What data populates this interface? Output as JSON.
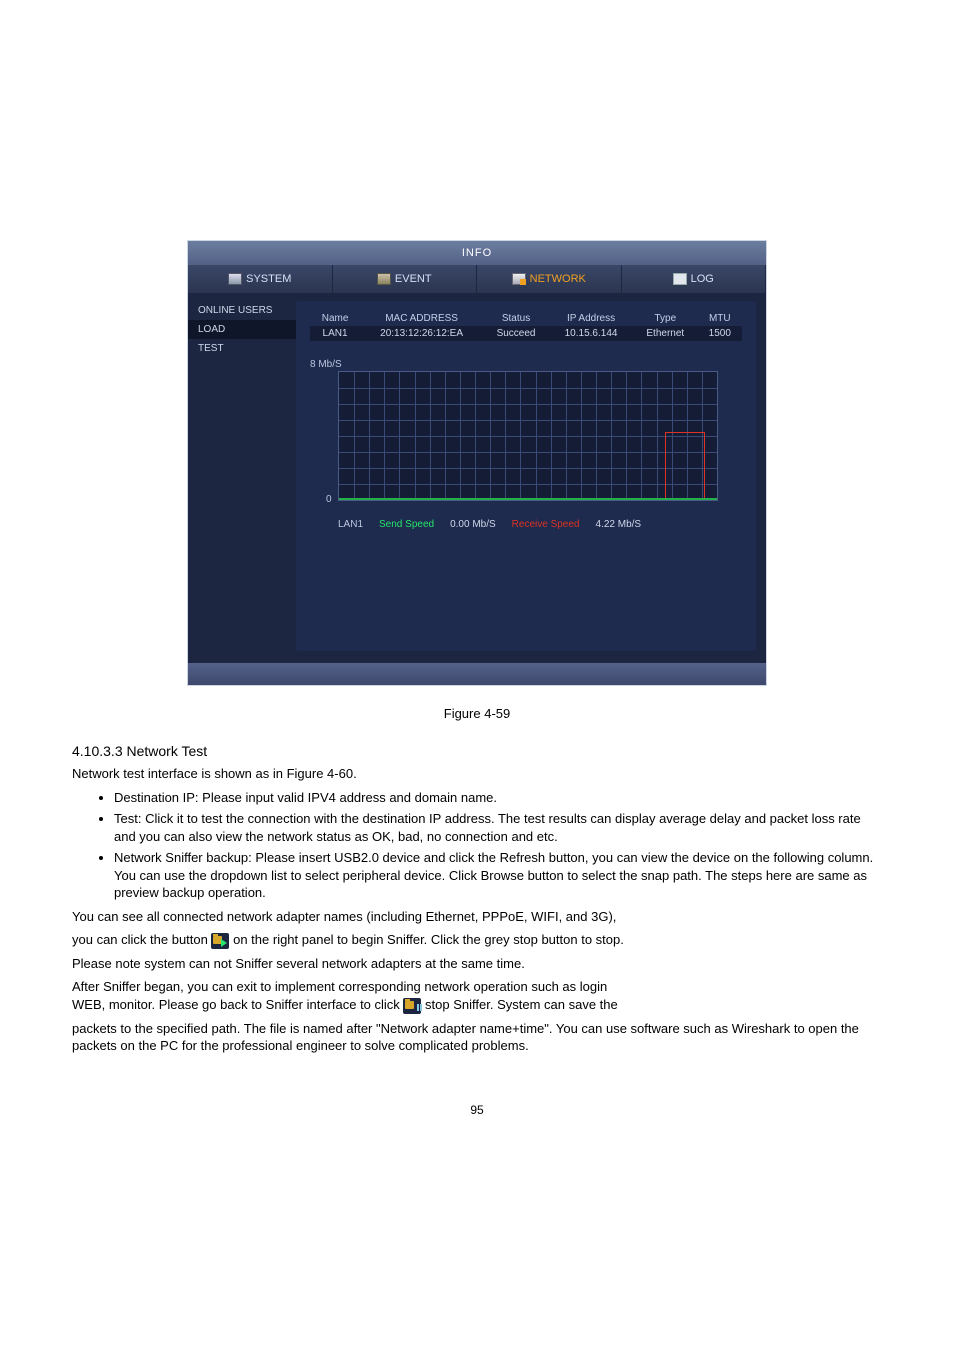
{
  "screenshot": {
    "title": "INFO",
    "tabs": {
      "system": "SYSTEM",
      "event": "EVENT",
      "network": "NETWORK",
      "log": "LOG"
    },
    "sidebar": {
      "items": [
        "ONLINE USERS",
        "LOAD",
        "TEST"
      ],
      "selected_index": 1
    },
    "table": {
      "headers": [
        "Name",
        "MAC ADDRESS",
        "Status",
        "IP Address",
        "Type",
        "MTU"
      ],
      "row": [
        "LAN1",
        "20:13:12:26:12:EA",
        "Succeed",
        "10.15.6.144",
        "Ethernet",
        "1500"
      ]
    },
    "chart_axis": {
      "top": "8 Mb/S",
      "bottom": "0"
    },
    "legend": {
      "lan": "LAN1",
      "send_label": "Send Speed",
      "send_value": "0.00 Mb/S",
      "recv_label": "Receive Speed",
      "recv_value": "4.22 Mb/S"
    }
  },
  "chart_data": {
    "type": "line",
    "title": "",
    "xlabel": "",
    "ylabel": "Mb/S",
    "ylim": [
      0,
      8
    ],
    "x": [
      0,
      1,
      2,
      3,
      4,
      5,
      6,
      7,
      8,
      9,
      10,
      11,
      12,
      13,
      14,
      15,
      16,
      17,
      18,
      19,
      20,
      21,
      22,
      23,
      24,
      25
    ],
    "series": [
      {
        "name": "Send Speed",
        "values": [
          0,
          0,
          0,
          0,
          0,
          0,
          0,
          0,
          0,
          0,
          0,
          0,
          0,
          0,
          0,
          0,
          0,
          0,
          0,
          0,
          0,
          0,
          0,
          0,
          0,
          0
        ]
      },
      {
        "name": "Receive Speed",
        "values": [
          0,
          0,
          0,
          0,
          0,
          0,
          0,
          0,
          0,
          0,
          0,
          0,
          0,
          0,
          0,
          0,
          0,
          0,
          0,
          0,
          0,
          0,
          4.2,
          4.2,
          4.2,
          3.6
        ]
      }
    ]
  },
  "caption": "Figure 4-59",
  "sec1_title": "4.10.3.3 Network Test",
  "sec1_p1": "Network test interface is shown as in Figure 4-60.",
  "bullets": {
    "b1": "Destination IP: Please input valid IPV4 address and domain name.",
    "b2": "Test: Click it to test the connection with the destination IP address. The test results can display average delay and packet loss rate and you can also view the network status as OK, bad, no connection and etc.",
    "b3": "Network Sniffer backup: Please insert USB2.0 device and click the Refresh button, you can view the device on the following column. You can use the dropdown list to select peripheral device. Click Browse button to select the snap path. The steps here are same as preview backup operation."
  },
  "para2": "You can see all connected network adapter names (including Ethernet, PPPoE, WIFI, and 3G),",
  "para3_a": "you can click the button ",
  "para3_b": " on the right panel to begin Sniffer. Click the grey stop button to stop.",
  "para4": "Please note system can not Sniffer several network adapters at the same time.",
  "para5_a": "After Sniffer began, you can exit to implement corresponding network operation such as login",
  "para5_b": "WEB, monitor. Please go back to Sniffer interface to click ",
  "para5_c": " stop Sniffer. System can save the",
  "para6": "packets to the specified path. The file is named after \"Network adapter name+time\". You can use software such as Wireshark to open the packets on the PC for the professional engineer to solve complicated problems.",
  "pagenum": "95"
}
